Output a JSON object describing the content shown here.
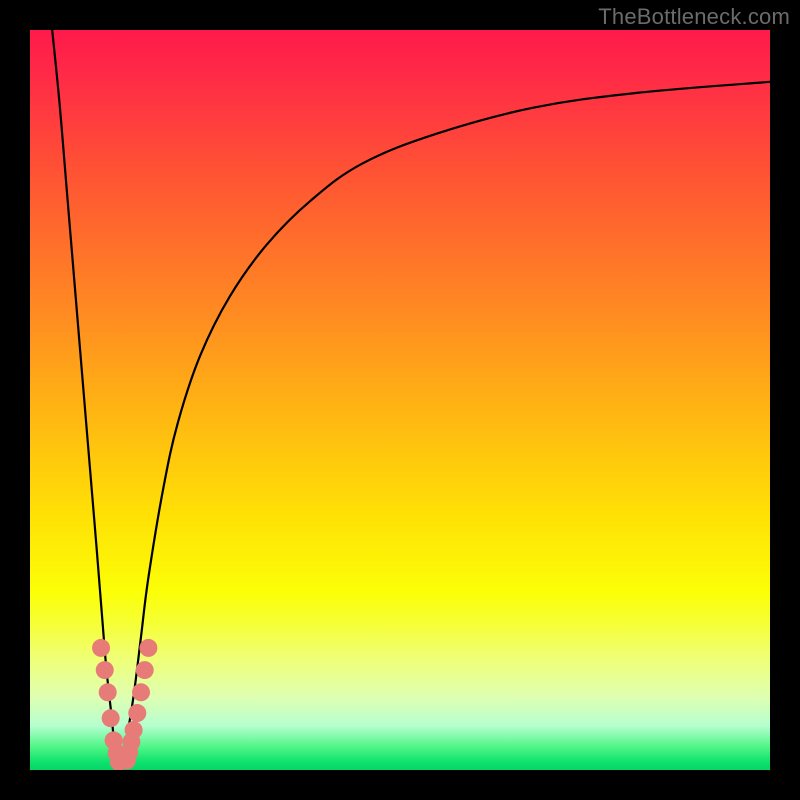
{
  "watermark": "TheBottleneck.com",
  "chart_data": {
    "type": "line",
    "title": "",
    "xlabel": "",
    "ylabel": "",
    "xlim": [
      0,
      100
    ],
    "ylim": [
      0,
      100
    ],
    "grid": false,
    "series": [
      {
        "name": "left-falling-curve",
        "x": [
          3,
          4,
          5,
          6,
          7,
          8,
          9,
          9.8,
          10.2,
          10.6,
          11,
          11.3,
          11.6,
          11.9
        ],
        "y": [
          100,
          90,
          78,
          66,
          54,
          42,
          30,
          20,
          15,
          11,
          7.5,
          4.5,
          2.5,
          1
        ]
      },
      {
        "name": "right-rising-curve",
        "x": [
          12.3,
          13,
          14,
          15,
          16,
          18,
          20,
          23,
          27,
          32,
          38,
          45,
          55,
          68,
          82,
          100
        ],
        "y": [
          1,
          4,
          10,
          18,
          26,
          38,
          47,
          56,
          64,
          71,
          77,
          82,
          86,
          89.5,
          91.5,
          93
        ]
      }
    ],
    "scatter": {
      "name": "highlighted-dots",
      "color": "#e77b78",
      "radius": 9,
      "points": [
        {
          "x": 9.6,
          "y": 16.5
        },
        {
          "x": 10.1,
          "y": 13.5
        },
        {
          "x": 10.5,
          "y": 10.5
        },
        {
          "x": 10.9,
          "y": 7.0
        },
        {
          "x": 11.3,
          "y": 4.0
        },
        {
          "x": 11.7,
          "y": 2.3
        },
        {
          "x": 12.0,
          "y": 1.1
        },
        {
          "x": 13.1,
          "y": 1.3
        },
        {
          "x": 13.4,
          "y": 2.4
        },
        {
          "x": 13.7,
          "y": 3.8
        },
        {
          "x": 14.0,
          "y": 5.4
        },
        {
          "x": 14.5,
          "y": 7.7
        },
        {
          "x": 15.0,
          "y": 10.5
        },
        {
          "x": 15.5,
          "y": 13.5
        },
        {
          "x": 16.0,
          "y": 16.5
        }
      ]
    }
  }
}
